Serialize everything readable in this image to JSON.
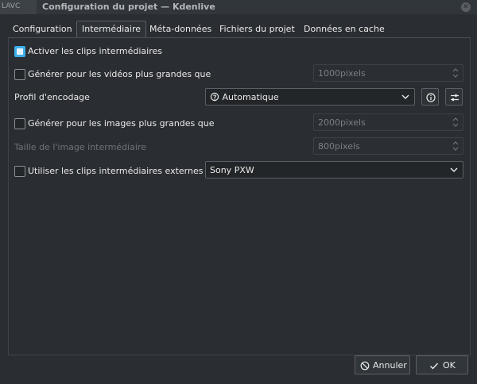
{
  "window": {
    "title": "Configuration du projet — Kdenlive",
    "background_fragment": "LAVC"
  },
  "tabs": [
    {
      "label": "Configuration",
      "active": false
    },
    {
      "label": "Intermédiaire",
      "active": true
    },
    {
      "label": "Méta-données",
      "active": false
    },
    {
      "label": "Fichiers du projet",
      "active": false
    },
    {
      "label": "Données en cache",
      "active": false
    }
  ],
  "proxy": {
    "enable_label": "Activer les clips intermédiaires",
    "enable_checked": true,
    "video_threshold_label": "Générer pour les vidéos plus grandes que",
    "video_threshold_checked": false,
    "video_threshold_value": "1000pixels",
    "encoding_profile_label": "Profil d'encodage",
    "encoding_profile_value": "Automatique",
    "image_threshold_label": "Générer pour les images plus grandes que",
    "image_threshold_checked": false,
    "image_threshold_value": "2000pixels",
    "image_size_label": "Taille de l'image intermédiaire",
    "image_size_value": "800pixels",
    "external_label": "Utiliser les clips intermédiaires externes",
    "external_checked": false,
    "external_value": "Sony PXW"
  },
  "buttons": {
    "cancel": "Annuler",
    "ok": "OK"
  },
  "colors": {
    "accent": "#3daee9",
    "background": "#2a2d31"
  }
}
